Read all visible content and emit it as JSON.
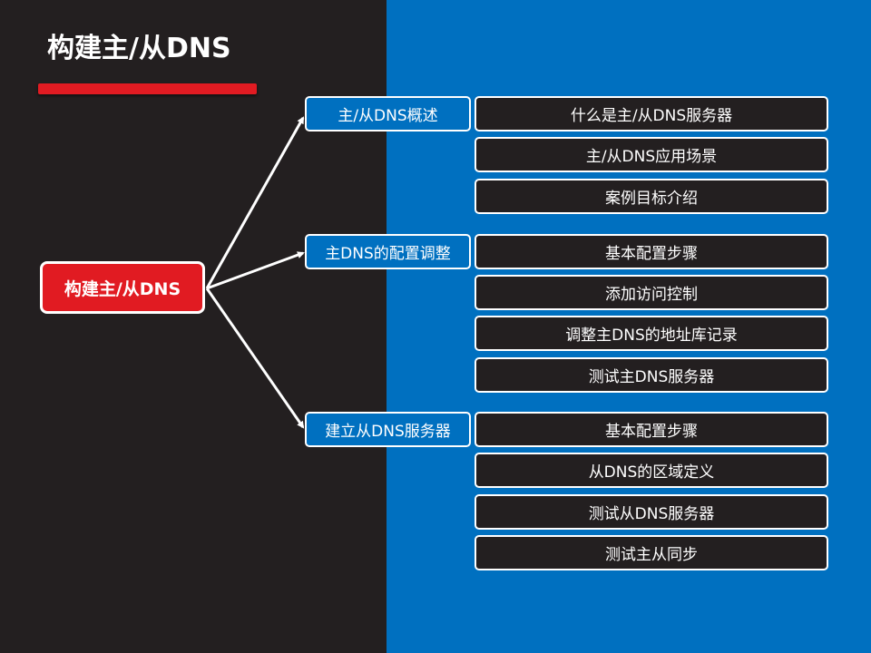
{
  "slide": {
    "title": "构建主/从DNS",
    "colors": {
      "dark": "#231f20",
      "blue": "#0070c0",
      "red": "#e11b22",
      "white": "#ffffff"
    }
  },
  "mindmap": {
    "root": "构建主/从DNS",
    "branches": [
      {
        "label": "主/从DNS概述",
        "items": [
          "什么是主/从DNS服务器",
          "主/从DNS应用场景",
          "案例目标介绍"
        ]
      },
      {
        "label": "主DNS的配置调整",
        "items": [
          "基本配置步骤",
          "添加访问控制",
          "调整主DNS的地址库记录",
          "测试主DNS服务器"
        ]
      },
      {
        "label": "建立从DNS服务器",
        "items": [
          "基本配置步骤",
          "从DNS的区域定义",
          "测试从DNS服务器",
          "测试主从同步"
        ]
      }
    ]
  }
}
